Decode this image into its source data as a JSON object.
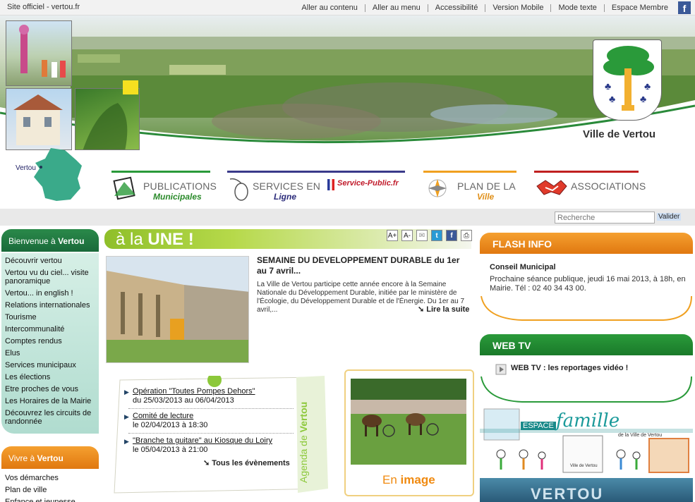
{
  "topbar": {
    "site": "Site officiel - vertou.fr",
    "links": [
      "Aller au contenu",
      "Aller au menu",
      "Accessibilité",
      "Version Mobile",
      "Mode texte",
      "Espace Membre"
    ],
    "facebook_icon": "f"
  },
  "banner": {
    "city_name": "Ville de Vertou",
    "map_label": "Vertou"
  },
  "nav": {
    "publications": {
      "line1": "PUBLICATIONS",
      "line2": "Municipales",
      "color": "#2a9a3a"
    },
    "services": {
      "line1": "SERVICES EN",
      "line2": "Ligne",
      "color": "#3a3a8a"
    },
    "service_public": "Service-Public.fr",
    "plan": {
      "line1": "PLAN DE LA",
      "line2": "Ville",
      "color": "#f0a020"
    },
    "associations": {
      "line1": "ASSOCIATIONS",
      "color": "#c02020"
    }
  },
  "search": {
    "placeholder": "Recherche",
    "button": "Valider"
  },
  "left": {
    "bienvenue": {
      "prefix": "Bienvenue à ",
      "name": "Vertou",
      "items": [
        "Découvrir vertou",
        "Vertou vu du ciel... visite panoramique",
        "Vertou... in english !",
        "Relations internationales",
        "Tourisme",
        "Intercommunalité",
        "Comptes rendus",
        "Elus",
        "Services municipaux",
        "Les élections",
        "Etre proches de vous",
        "Les Horaires de la Mairie",
        "Découvrez les circuits de randonnée"
      ]
    },
    "vivre": {
      "prefix": "Vivre à ",
      "name": "Vertou",
      "items": [
        "Vos démarches",
        "Plan de ville",
        "Enfance et jeunesse"
      ]
    }
  },
  "une": {
    "title_light": "à la ",
    "title_bold": "UNE !",
    "tools": [
      "A+",
      "A-",
      "✉",
      "t",
      "f",
      "⎙"
    ],
    "article": {
      "title": "SEMAINE DU DEVELOPPEMENT DURABLE du 1er au 7 avril...",
      "text": "La Ville de Vertou participe cette année encore à la Semaine Nationale du Développement Durable, initiée par le ministère de l'Écologie, du Développement Durable et de l'Énergie. Du 1er au 7 avril,...",
      "more": "Lire la suite"
    }
  },
  "agenda": {
    "label_light": "Agenda de ",
    "label_bold": "Vertou",
    "events": [
      {
        "title": "Opération \"Toutes Pompes Dehors\"",
        "date": "du 25/03/2013 au 06/04/2013"
      },
      {
        "title": "Comité de lecture",
        "date": "le 02/04/2013 à 18:30"
      },
      {
        "title": "\"Branche ta guitare\" au Kiosque du Loiry",
        "date": "le 05/04/2013 à 21:00"
      }
    ],
    "all": "Tous les évènements"
  },
  "image": {
    "prefix": "En ",
    "bold": "image"
  },
  "right": {
    "flash": {
      "heading": "FLASH INFO",
      "title": "Conseil Municipal",
      "text": "Prochaine séance publique, jeudi 16 mai 2013, à 18h, en Mairie. Tél : 02 40 34 43 00."
    },
    "webtv": {
      "heading": "WEB TV",
      "line": "WEB TV : les reportages vidéo !"
    },
    "famille": {
      "espace": "ESPACE",
      "famille": "famille",
      "de": "de la Ville de Vertou",
      "card": "Ville de Vertou"
    },
    "vertou_box": "VERTOU"
  },
  "colors": {
    "green": "#7cb82a",
    "orange": "#f08a10",
    "teal": "#1a8a8a"
  }
}
